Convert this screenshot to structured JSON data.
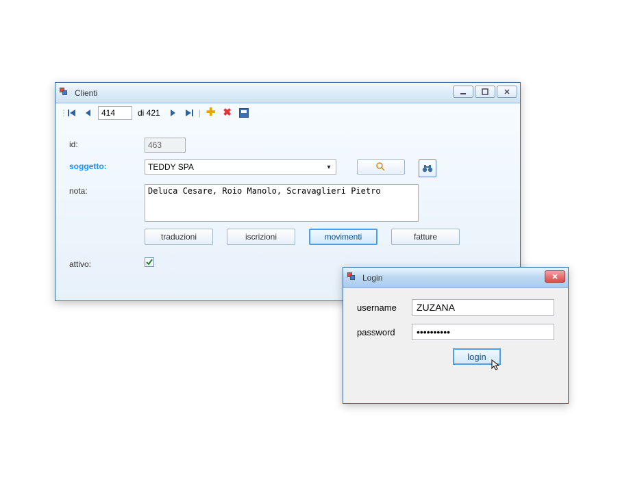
{
  "clienti": {
    "title": "Clienti",
    "nav": {
      "pos": "414",
      "of": "di 421"
    },
    "labels": {
      "id": "id:",
      "soggetto": "soggetto:",
      "nota": "nota:",
      "attivo": "attivo:"
    },
    "fields": {
      "id": "463",
      "soggetto": "TEDDY SPA",
      "nota": "Deluca Cesare, Roio Manolo, Scravaglieri Pietro",
      "attivo": true
    },
    "buttons": {
      "traduzioni": "traduzioni",
      "iscrizioni": "iscrizioni",
      "movimenti": "movimenti",
      "fatture": "fatture"
    }
  },
  "login": {
    "title": "Login",
    "labels": {
      "username": "username",
      "password": "password"
    },
    "fields": {
      "username": "ZUZANA",
      "password": "••••••••••"
    },
    "button": "login"
  },
  "colors": {
    "accent": "#1e90ff"
  }
}
